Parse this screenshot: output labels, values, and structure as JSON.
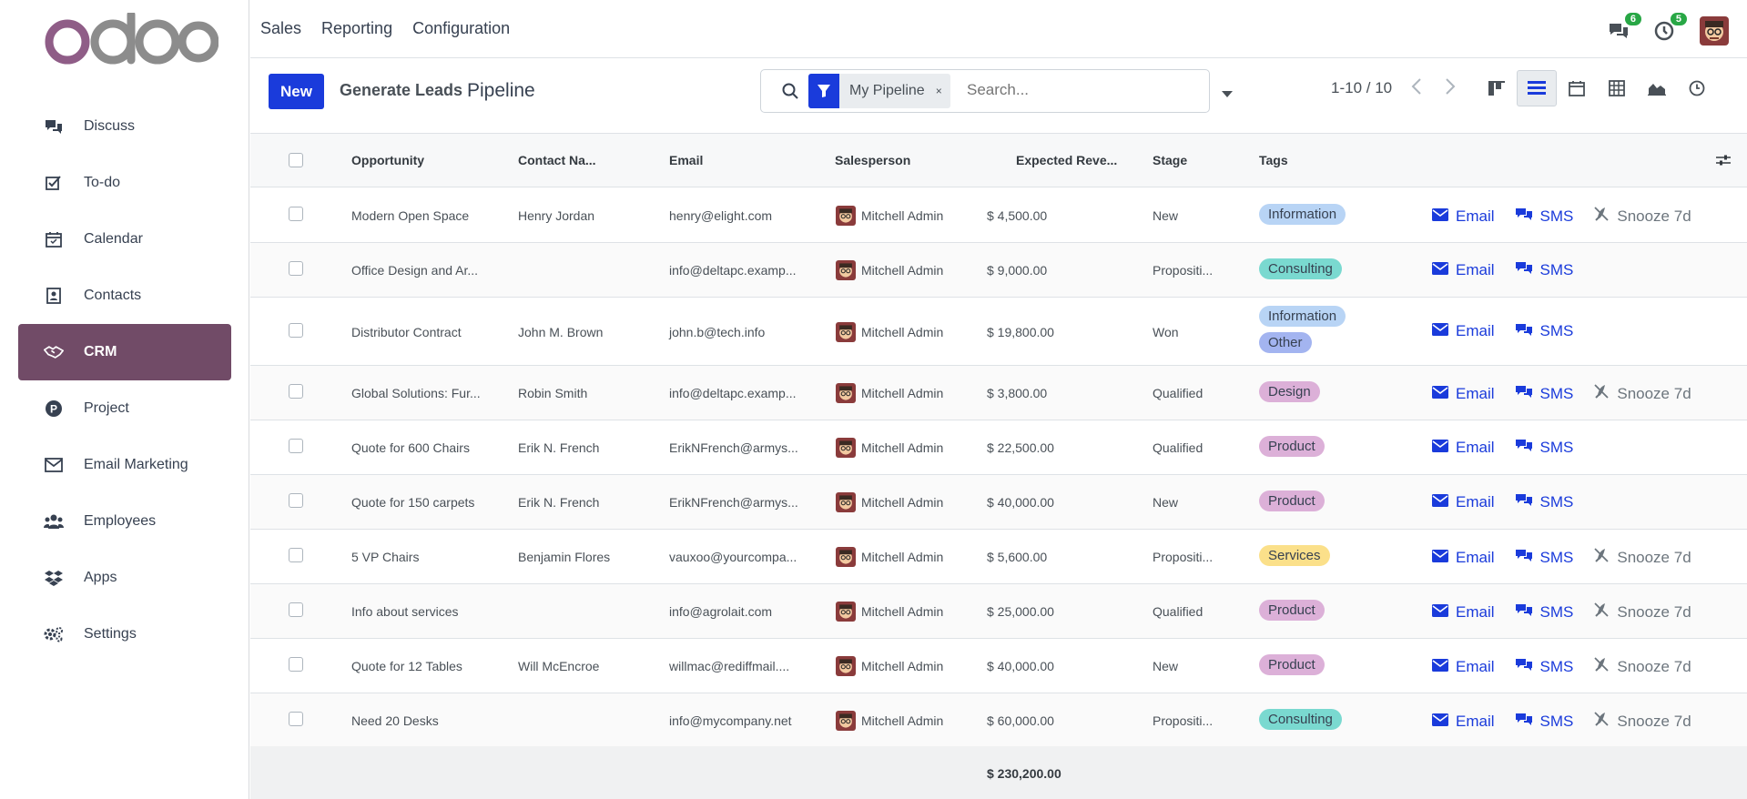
{
  "app": {
    "logo_text": "odoo",
    "nav": [
      {
        "label": "Discuss",
        "icon": "discuss-icon"
      },
      {
        "label": "To-do",
        "icon": "todo-icon"
      },
      {
        "label": "Calendar",
        "icon": "calendar-icon"
      },
      {
        "label": "Contacts",
        "icon": "contacts-icon"
      },
      {
        "label": "CRM",
        "icon": "crm-handshake-icon"
      },
      {
        "label": "Project",
        "icon": "project-icon"
      },
      {
        "label": "Email Marketing",
        "icon": "email-marketing-icon"
      },
      {
        "label": "Employees",
        "icon": "employees-icon"
      },
      {
        "label": "Apps",
        "icon": "apps-icon"
      },
      {
        "label": "Settings",
        "icon": "settings-icon"
      }
    ],
    "active_nav": "CRM"
  },
  "topmenu": [
    "Sales",
    "Reporting",
    "Configuration"
  ],
  "systray": {
    "messages_count": "6",
    "activities_count": "5"
  },
  "control": {
    "new_label": "New",
    "generate_label": "Generate Leads",
    "title": "Pipeline",
    "facet": "My Pipeline",
    "facet_remove": "×",
    "search_placeholder": "Search...",
    "pager": "1-10 / 10"
  },
  "table": {
    "headers": {
      "opportunity": "Opportunity",
      "contact": "Contact Na...",
      "email": "Email",
      "salesperson": "Salesperson",
      "revenue": "Expected Reve...",
      "stage": "Stage",
      "tags": "Tags"
    },
    "rows": [
      {
        "opportunity": "Modern Open Space",
        "contact": "Henry Jordan",
        "email": "henry@elight.com",
        "salesperson": "Mitchell Admin",
        "revenue": "$ 4,500.00",
        "stage": "New",
        "tags": [
          "Information"
        ],
        "snooze": true
      },
      {
        "opportunity": "Office Design and Ar...",
        "contact": "",
        "email": "info@deltapc.examp...",
        "salesperson": "Mitchell Admin",
        "revenue": "$ 9,000.00",
        "stage": "Propositi...",
        "tags": [
          "Consulting"
        ],
        "snooze": false
      },
      {
        "opportunity": "Distributor Contract",
        "contact": "John M. Brown",
        "email": "john.b@tech.info",
        "salesperson": "Mitchell Admin",
        "revenue": "$ 19,800.00",
        "stage": "Won",
        "tags": [
          "Information",
          "Other"
        ],
        "snooze": false
      },
      {
        "opportunity": "Global Solutions: Fur...",
        "contact": "Robin Smith",
        "email": "info@deltapc.examp...",
        "salesperson": "Mitchell Admin",
        "revenue": "$ 3,800.00",
        "stage": "Qualified",
        "tags": [
          "Design"
        ],
        "snooze": true
      },
      {
        "opportunity": "Quote for 600 Chairs",
        "contact": "Erik N. French",
        "email": "ErikNFrench@armys...",
        "salesperson": "Mitchell Admin",
        "revenue": "$ 22,500.00",
        "stage": "Qualified",
        "tags": [
          "Product"
        ],
        "snooze": false
      },
      {
        "opportunity": "Quote for 150 carpets",
        "contact": "Erik N. French",
        "email": "ErikNFrench@armys...",
        "salesperson": "Mitchell Admin",
        "revenue": "$ 40,000.00",
        "stage": "New",
        "tags": [
          "Product"
        ],
        "snooze": false
      },
      {
        "opportunity": "5 VP Chairs",
        "contact": "Benjamin Flores",
        "email": "vauxoo@yourcompa...",
        "salesperson": "Mitchell Admin",
        "revenue": "$ 5,600.00",
        "stage": "Propositi...",
        "tags": [
          "Services"
        ],
        "snooze": true
      },
      {
        "opportunity": "Info about services",
        "contact": "",
        "email": "info@agrolait.com",
        "salesperson": "Mitchell Admin",
        "revenue": "$ 25,000.00",
        "stage": "Qualified",
        "tags": [
          "Product"
        ],
        "snooze": true
      },
      {
        "opportunity": "Quote for 12 Tables",
        "contact": "Will McEncroe",
        "email": "willmac@rediffmail....",
        "salesperson": "Mitchell Admin",
        "revenue": "$ 40,000.00",
        "stage": "New",
        "tags": [
          "Product"
        ],
        "snooze": true
      },
      {
        "opportunity": "Need 20 Desks",
        "contact": "",
        "email": "info@mycompany.net",
        "salesperson": "Mitchell Admin",
        "revenue": "$ 60,000.00",
        "stage": "Propositi...",
        "tags": [
          "Consulting"
        ],
        "snooze": true
      }
    ],
    "actions": {
      "email": "Email",
      "sms": "SMS",
      "snooze": "Snooze 7d"
    },
    "total": "$ 230,200.00"
  },
  "tag_colors": {
    "Information": "#b8d4f5",
    "Consulting": "#7ad9d0",
    "Other": "#a3b4f0",
    "Design": "#dcb0d8",
    "Product": "#dcb0d8",
    "Services": "#fbe08a"
  },
  "colors": {
    "brand": "#714b67",
    "primary": "#1a3bdb"
  }
}
